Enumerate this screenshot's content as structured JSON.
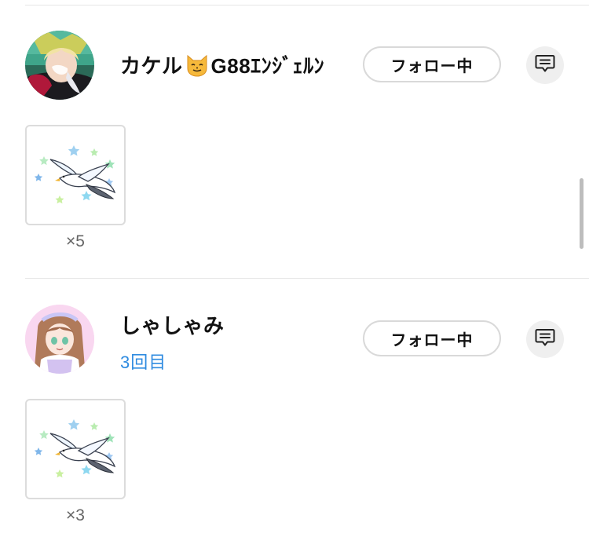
{
  "entries": [
    {
      "username_prefix": "カケル",
      "username_emoji": "cat-face-emoji",
      "username_suffix": "G88ｴﾝｼﾞｪﾙﾝ",
      "sub_count": "",
      "follow_label": "フォロー中",
      "gift_icon": "seagull-stars-icon",
      "gift_quantity": "×5"
    },
    {
      "username_prefix": "しゃしゃみ",
      "username_emoji": "",
      "username_suffix": "",
      "sub_count": "3回目",
      "follow_label": "フォロー中",
      "gift_icon": "seagull-stars-icon",
      "gift_quantity": "×3"
    }
  ],
  "colors": {
    "accent_blue": "#2f8be0",
    "divider": "#e6e6e6",
    "button_border": "#d9d9d9",
    "message_button_bg": "#efefef"
  }
}
